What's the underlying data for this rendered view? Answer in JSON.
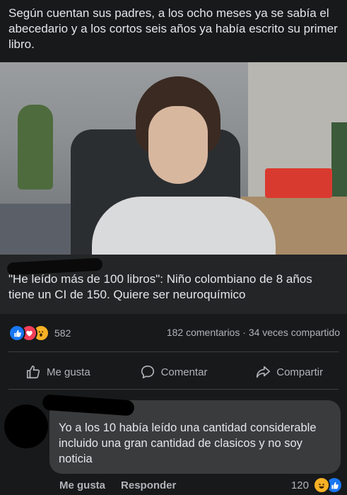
{
  "post": {
    "text": "Según cuentan sus padres, a los ocho meses ya se sabía el abecedario y a los cortos seis años ya había escrito su primer libro."
  },
  "link_preview": {
    "title": "\"He leído más de 100 libros\": Niño colombiano de 8 años tiene un CI de 150. Quiere ser neuroquímico"
  },
  "stats": {
    "reaction_count": "582",
    "comments": "182 comentarios",
    "separator": "·",
    "shares": "34 veces compartido"
  },
  "actions": {
    "like": "Me gusta",
    "comment": "Comentar",
    "share": "Compartir"
  },
  "comment": {
    "text": "Yo a los 10 había leído una cantidad considerable incluido una gran cantidad de clasicos y no soy noticia",
    "like_label": "Me gusta",
    "reply_label": "Responder",
    "reaction_count": "120"
  },
  "colors": {
    "background": "#18191a",
    "surface": "#242526",
    "bubble": "#3a3b3c",
    "like_blue": "#1877f2",
    "love_red": "#f33e58",
    "wow_yellow": "#f7b125"
  },
  "icons": {
    "reactions": [
      "like-icon",
      "love-icon",
      "wow-icon"
    ],
    "actions": [
      "thumbs-up-icon",
      "comment-icon",
      "share-icon"
    ]
  }
}
